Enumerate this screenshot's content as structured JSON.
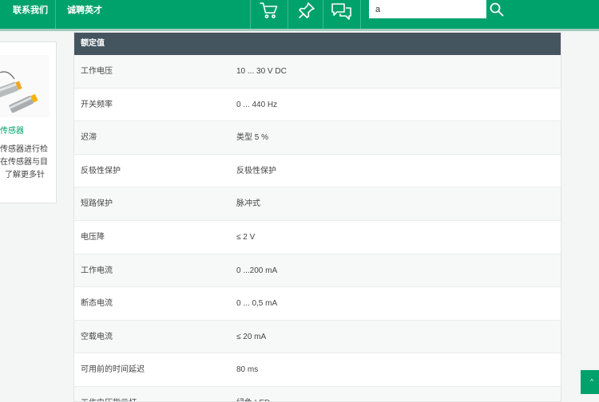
{
  "topbar": {
    "contact": "联系我们",
    "careers": "诚聘英才",
    "icons": [
      "cart-icon",
      "pin-icon",
      "chat-icon",
      "search-icon"
    ],
    "search_value": "a"
  },
  "side": {
    "title": "传感器",
    "lines": [
      "传感器进行检",
      "在传感器与目",
      "了解更多针"
    ]
  },
  "table": {
    "header": "额定值",
    "rows": [
      {
        "key": "工作电压",
        "value": "10 ... 30 V DC"
      },
      {
        "key": "开关频率",
        "value": "0 ... 440 Hz"
      },
      {
        "key": "迟滞",
        "value": "类型 5 %"
      },
      {
        "key": "反极性保护",
        "value": "反极性保护"
      },
      {
        "key": "短路保护",
        "value": "脉冲式"
      },
      {
        "key": "电压降",
        "value": "≤ 2 V"
      },
      {
        "key": "工作电流",
        "value": "0 ...200 mA"
      },
      {
        "key": "断态电流",
        "value": "0 ... 0,5 mA"
      },
      {
        "key": "空载电流",
        "value": "≤ 20 mA"
      },
      {
        "key": "可用前的时间延迟",
        "value": "80 ms"
      },
      {
        "key": "工作电压指示灯",
        "value": "绿色 LED"
      }
    ]
  },
  "to_top": "^",
  "colors": {
    "brand": "#00a26c",
    "table_header": "#455560"
  }
}
